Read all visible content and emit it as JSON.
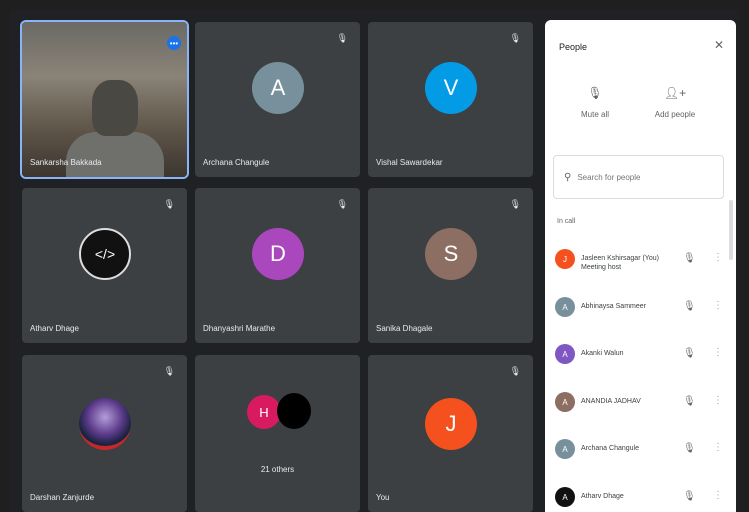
{
  "tiles": [
    {
      "name": "Sankarsha Bakkada",
      "type": "video"
    },
    {
      "name": "Archana Changule",
      "initial": "A",
      "color": "#78909c"
    },
    {
      "name": "Vishal Sawardekar",
      "initial": "V",
      "color": "#039be5"
    },
    {
      "name": "Atharv Dhage",
      "initial": "</>",
      "color": "#111111"
    },
    {
      "name": "Dhanyashri Marathe",
      "initial": "D",
      "color": "#ab47bc"
    },
    {
      "name": "Sanika Dhagale",
      "initial": "S",
      "color": "#8d6e63"
    },
    {
      "name": "Darshan Zanjurde",
      "initial": "",
      "color": "#1a2340"
    },
    {
      "name": "21 others",
      "initial": "H",
      "color": "#d81b60"
    },
    {
      "name": "You",
      "initial": "J",
      "color": "#f4511e"
    }
  ],
  "panel": {
    "title": "People",
    "close": "✕",
    "mute_all_label": "Mute all",
    "add_people_label": "Add people",
    "search_placeholder": "Search for people",
    "section_label": "In call",
    "people": [
      {
        "name": "Jasleen Kshirsagar (You) Meeting host",
        "initial": "J",
        "color": "#f4511e"
      },
      {
        "name": "Abhinaysa Sammeer",
        "initial": "A",
        "color": "#78909c"
      },
      {
        "name": "Akanki Walun",
        "initial": "A",
        "color": "#7e57c2"
      },
      {
        "name": "ANANDIA JADHAV",
        "initial": "A",
        "color": "#8d6e63"
      },
      {
        "name": "Archana Changule",
        "initial": "A",
        "color": "#78909c"
      },
      {
        "name": "Atharv Dhage",
        "initial": "A",
        "color": "#111111"
      }
    ]
  },
  "icons": {
    "mic_off": "🎙︎",
    "more": "⋮",
    "close": "✕",
    "search": "🔍︎"
  }
}
